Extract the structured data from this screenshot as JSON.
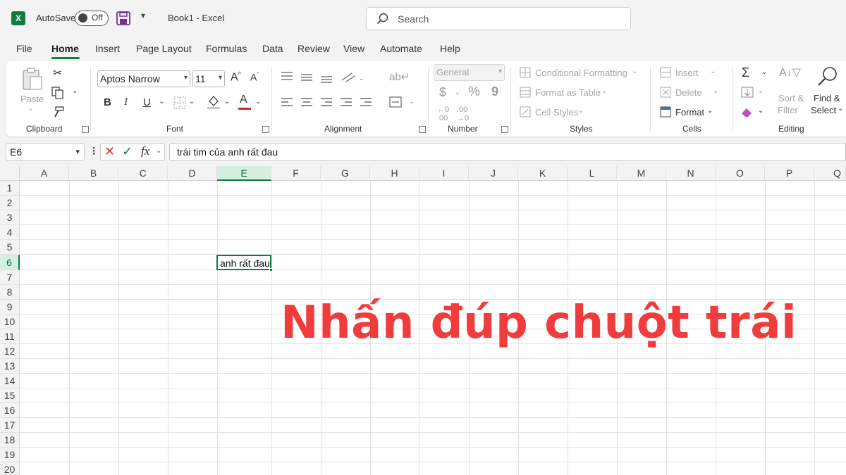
{
  "titlebar": {
    "logo": "X",
    "autosave_label": "AutoSave",
    "autosave_state": "Off",
    "document_title": "Book1  -  Excel",
    "search_placeholder": "Search"
  },
  "tabs": [
    "File",
    "Home",
    "Insert",
    "Page Layout",
    "Formulas",
    "Data",
    "Review",
    "View",
    "Automate",
    "Help"
  ],
  "active_tab": "Home",
  "ribbon": {
    "clipboard": {
      "label": "Clipboard",
      "paste": "Paste"
    },
    "font": {
      "label": "Font",
      "font_name": "Aptos Narrow",
      "font_size": "11",
      "bold": "B",
      "italic": "I",
      "underline": "U"
    },
    "alignment": {
      "label": "Alignment"
    },
    "number": {
      "label": "Number",
      "format": "General",
      "currency": "$",
      "percent": "%",
      "comma": "9"
    },
    "styles": {
      "label": "Styles",
      "conditional": "Conditional Formatting",
      "format_table": "Format as Table",
      "cell_styles": "Cell Styles"
    },
    "cells": {
      "label": "Cells",
      "insert": "Insert",
      "delete": "Delete",
      "format": "Format"
    },
    "editing": {
      "label": "Editing",
      "sort": "Sort &",
      "filter": "Filter",
      "find": "Find &",
      "select": "Select"
    }
  },
  "formula_bar": {
    "name_box": "E6",
    "fx": "fx",
    "content": "trái tim của anh rất đau"
  },
  "grid": {
    "columns": [
      "A",
      "B",
      "C",
      "D",
      "E",
      "F",
      "G",
      "H",
      "I",
      "J",
      "K",
      "L",
      "M",
      "N",
      "O",
      "P",
      "Q"
    ],
    "rows": [
      "1",
      "2",
      "3",
      "4",
      "5",
      "6",
      "7",
      "8",
      "9",
      "10",
      "11",
      "12",
      "13",
      "14",
      "15",
      "16",
      "17",
      "18",
      "19",
      "20"
    ],
    "selected_column": "E",
    "selected_row": "6",
    "active_cell_display": "anh rất đau"
  },
  "overlay_caption": "Nhấn đúp chuột trái",
  "colors": {
    "accent": "#107c41",
    "caption": "#f03c3c"
  }
}
